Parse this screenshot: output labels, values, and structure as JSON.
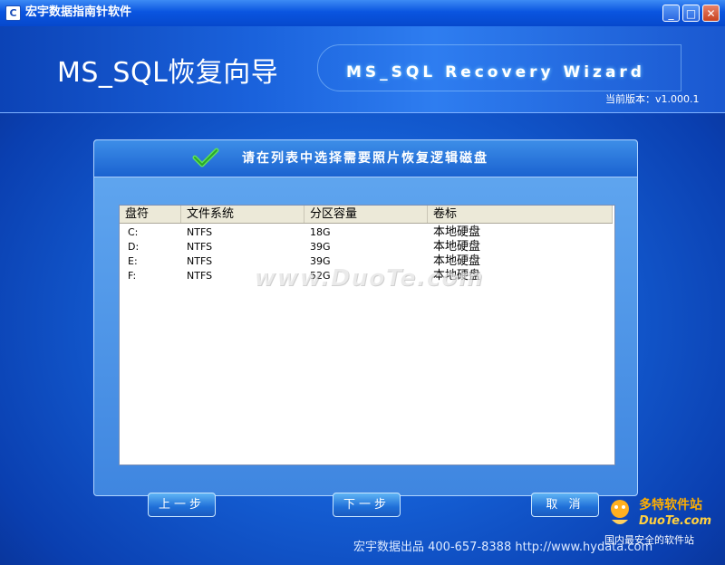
{
  "window": {
    "title": "宏宇数据指南针软件",
    "min_icon": "minimize-icon",
    "max_icon": "maximize-icon",
    "close_icon": "close-icon"
  },
  "header": {
    "app_title": "MS_SQL恢复向导",
    "app_subtitle": "MS_SQL Recovery Wizard",
    "version": "当前版本：v1.000.1"
  },
  "panel": {
    "instruction": "请在列表中选择需要照片恢复逻辑磁盘",
    "check_icon": "checkmark-icon",
    "columns": [
      "盘符",
      "文件系统",
      "分区容量",
      "卷标"
    ],
    "rows": [
      {
        "drive": "C:",
        "fs": "NTFS",
        "size": "18G",
        "label": "本地硬盘"
      },
      {
        "drive": "D:",
        "fs": "NTFS",
        "size": "39G",
        "label": "本地硬盘"
      },
      {
        "drive": "E:",
        "fs": "NTFS",
        "size": "39G",
        "label": "本地硬盘"
      },
      {
        "drive": "F:",
        "fs": "NTFS",
        "size": "52G",
        "label": "本地硬盘"
      }
    ]
  },
  "buttons": {
    "prev": "上一步",
    "next": "下一步",
    "cancel": "取 消"
  },
  "footer": {
    "text": "宏宇数据出品  400-657-8388  http://www.hydata.com"
  },
  "watermark": {
    "text": "www.DuoTe.com",
    "corner_brand": "多特软件站",
    "corner_site": "DuoTe.com",
    "corner_slogan": "国内最安全的软件站"
  },
  "colors": {
    "titlebar": "#0a55e0",
    "background": "#1560d6",
    "panel": "#3f86e0",
    "accent": "#ffae00"
  }
}
